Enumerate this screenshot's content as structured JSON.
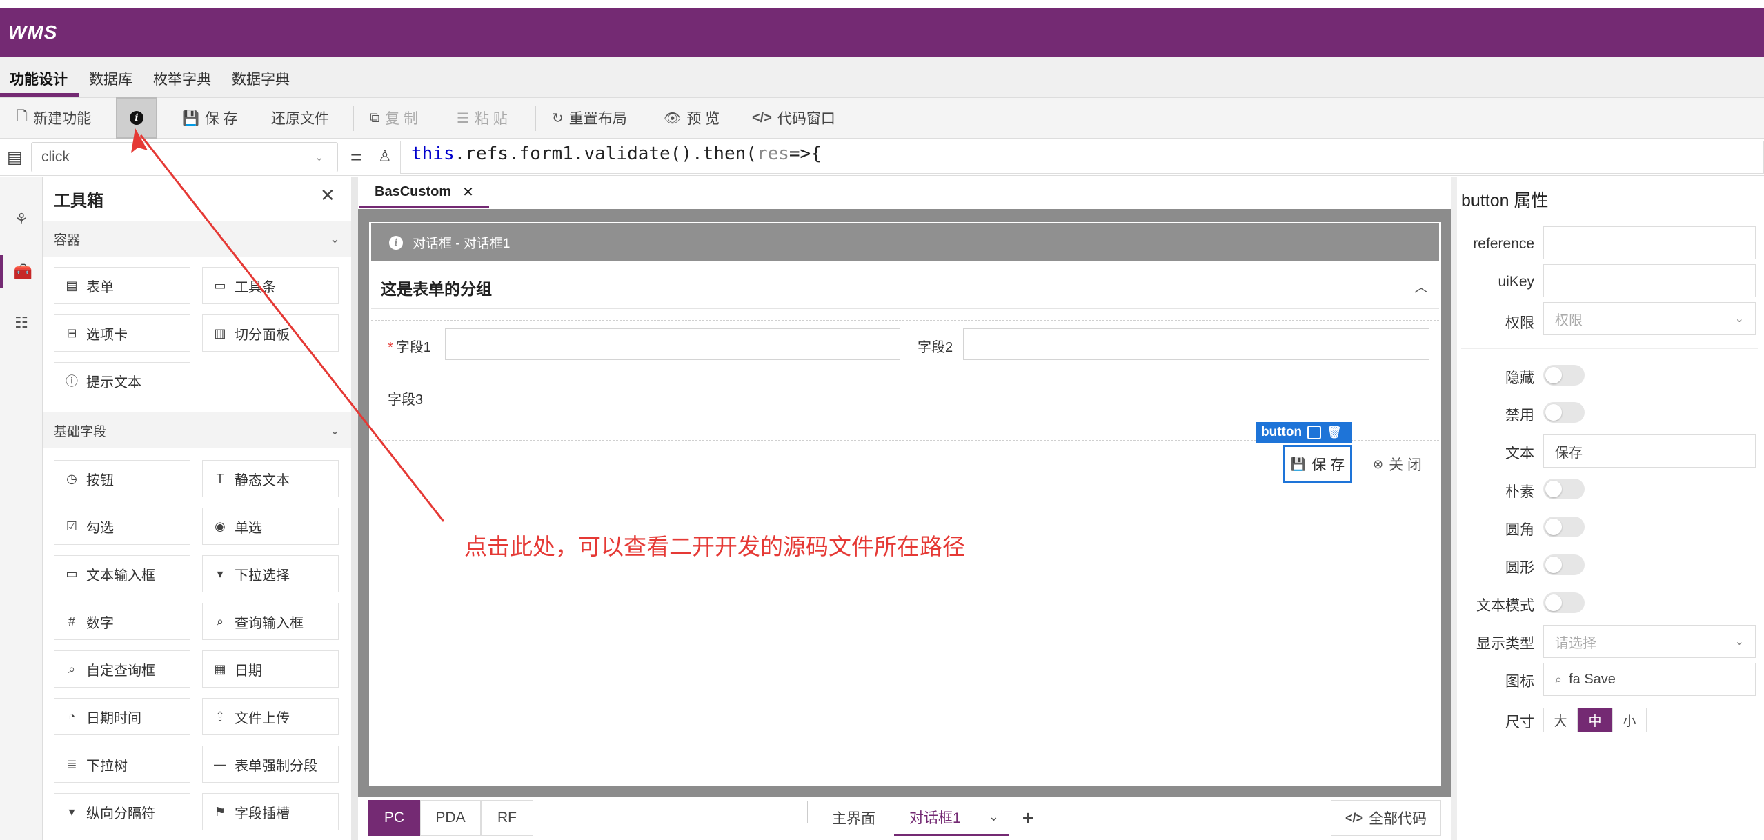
{
  "app": {
    "logo": "WMS"
  },
  "menu": {
    "items": [
      "功能设计",
      "数据库",
      "枚举字典",
      "数据字典"
    ]
  },
  "toolbar": {
    "new_label": "新建功能",
    "save_label": "保 存",
    "restore_label": "还原文件",
    "copy_label": "复 制",
    "paste_label": "粘 贴",
    "reset_label": "重置布局",
    "preview_label": "预 览",
    "code_label": "代码窗口"
  },
  "codebar": {
    "event": "click",
    "code_kw": "this",
    "code_mid": ".refs.form1.validate().then(",
    "code_arg": "res",
    "code_tail": "=>{"
  },
  "toolbox": {
    "title": "工具箱",
    "sections": [
      {
        "label": "容器",
        "items": [
          {
            "label": "表单",
            "icon": "form-icon"
          },
          {
            "label": "工具条",
            "icon": "toolbar-icon"
          },
          {
            "label": "选项卡",
            "icon": "tabs-icon"
          },
          {
            "label": "切分面板",
            "icon": "split-icon"
          },
          {
            "label": "提示文本",
            "icon": "info-icon"
          }
        ]
      },
      {
        "label": "基础字段",
        "items": [
          {
            "label": "按钮",
            "icon": "clock-icon"
          },
          {
            "label": "静态文本",
            "icon": "text-icon"
          },
          {
            "label": "勾选",
            "icon": "checkbox-icon"
          },
          {
            "label": "单选",
            "icon": "radio-icon"
          },
          {
            "label": "文本输入框",
            "icon": "textbox-icon"
          },
          {
            "label": "下拉选择",
            "icon": "dropdown-icon"
          },
          {
            "label": "数字",
            "icon": "number-icon"
          },
          {
            "label": "查询输入框",
            "icon": "query-input-icon"
          },
          {
            "label": "自定查询框",
            "icon": "custom-query-icon"
          },
          {
            "label": "日期",
            "icon": "calendar-icon"
          },
          {
            "label": "日期时间",
            "icon": "datetime-icon"
          },
          {
            "label": "文件上传",
            "icon": "upload-icon"
          },
          {
            "label": "下拉树",
            "icon": "tree-icon"
          },
          {
            "label": "表单强制分段",
            "icon": "dash-icon"
          },
          {
            "label": "纵向分隔符",
            "icon": "caret-icon"
          },
          {
            "label": "字段插槽",
            "icon": "flag-icon"
          }
        ]
      }
    ]
  },
  "designer": {
    "tab": "BasCustom",
    "dialog_title": "对话框 - 对话框1",
    "group_title": "这是表单的分组",
    "fields": [
      "字段1",
      "字段2",
      "字段3"
    ],
    "selected_tag": "button",
    "save_btn": "保 存",
    "close_btn": "关 闭",
    "annotation": "点击此处，可以查看二开开发的源码文件所在路径"
  },
  "bottom": {
    "platforms": [
      "PC",
      "PDA",
      "RF"
    ],
    "views": [
      "主界面",
      "对话框1"
    ],
    "add": "+",
    "all_code": "全部代码"
  },
  "props": {
    "title": "button 属性",
    "labels": {
      "reference": "reference",
      "uikey": "uiKey",
      "perm": "权限",
      "hidden": "隐藏",
      "disabled": "禁用",
      "text": "文本",
      "plain": "朴素",
      "round": "圆角",
      "circle": "圆形",
      "textmode": "文本模式",
      "display": "显示类型",
      "icon": "图标",
      "size": "尺寸"
    },
    "perm_ph": "权限",
    "text_value": "保存",
    "display_ph": "请选择",
    "icon_value": "fa Save",
    "sizes": [
      "大",
      "中",
      "小"
    ],
    "size_selected": "中"
  },
  "colors": {
    "brand": "#742a73",
    "selection": "#1e74d8",
    "annotation": "#e53935"
  }
}
